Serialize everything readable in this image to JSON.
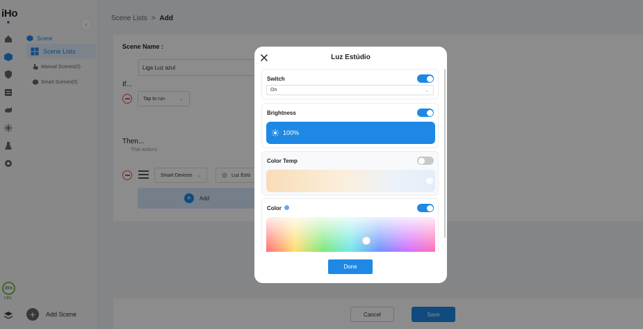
{
  "app": {
    "logo": "iHost"
  },
  "cpu": {
    "percent": "35%",
    "label": "CPU"
  },
  "sidebar": {
    "section": "Scene",
    "items": [
      {
        "label": "Scene Lists"
      },
      {
        "label": "Manual Scenes(0)"
      },
      {
        "label": "Smart Scenes(0)"
      }
    ],
    "add_scene": "Add Scene"
  },
  "breadcrumb": {
    "parent": "Scene Lists",
    "separator": ">",
    "current": "Add"
  },
  "form": {
    "scene_name_label": "Scene Name :",
    "scene_name_value": "Liga Luz azul",
    "if_label": "If...",
    "trigger_value": "Tap to run",
    "then_label": "Then...",
    "then_sub": "That actions",
    "action_source": "Smart Devices",
    "action_device": "Luz Estú",
    "add_label": "Add"
  },
  "footer": {
    "cancel": "Cancel",
    "save": "Save"
  },
  "modal": {
    "title": "Luz Estúdio",
    "switch": {
      "label": "Switch",
      "enabled": true,
      "value": "On"
    },
    "brightness": {
      "label": "Brightness",
      "enabled": true,
      "value": "100%"
    },
    "color_temp": {
      "label": "Color Temp",
      "enabled": false
    },
    "color": {
      "label": "Color",
      "enabled": true,
      "selected_color": "#6aa6f8"
    },
    "done": "Done"
  },
  "colors": {
    "accent": "#1e88e5",
    "danger": "#e54b4b",
    "toggle_off": "#c9c9c9"
  }
}
